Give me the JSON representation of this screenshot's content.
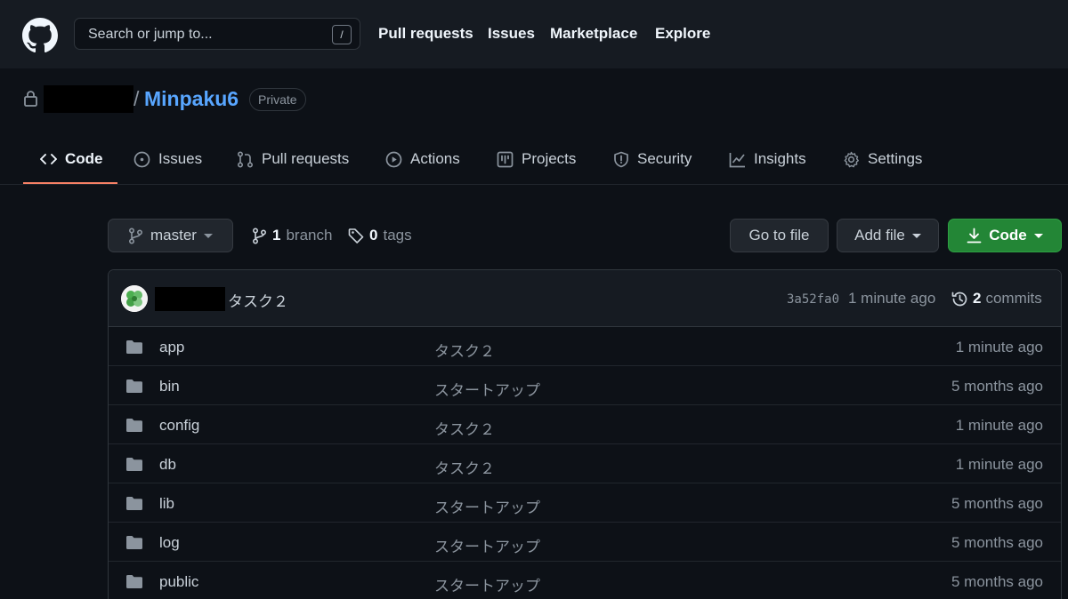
{
  "header": {
    "search_placeholder": "Search or jump to...",
    "search_shortcut": "/",
    "nav": [
      "Pull requests",
      "Issues",
      "Marketplace",
      "Explore"
    ]
  },
  "repo": {
    "separator": "/",
    "name": "Minpaku6",
    "visibility": "Private"
  },
  "tabs": [
    {
      "label": "Code",
      "icon": "code-icon",
      "active": true
    },
    {
      "label": "Issues",
      "icon": "issue-opened-icon"
    },
    {
      "label": "Pull requests",
      "icon": "git-pull-request-icon"
    },
    {
      "label": "Actions",
      "icon": "play-icon"
    },
    {
      "label": "Projects",
      "icon": "project-icon"
    },
    {
      "label": "Security",
      "icon": "shield-icon"
    },
    {
      "label": "Insights",
      "icon": "graph-icon"
    },
    {
      "label": "Settings",
      "icon": "gear-icon"
    }
  ],
  "branch_bar": {
    "branch": "master",
    "branch_count": "1",
    "branch_label": "branch",
    "tag_count": "0",
    "tag_label": "tags",
    "go_to_file": "Go to file",
    "add_file": "Add file",
    "code": "Code"
  },
  "latest_commit": {
    "message": "タスク２",
    "hash": "3a52fa0",
    "time": "1 minute ago",
    "commit_count": "2",
    "commit_label": "commits"
  },
  "files": [
    {
      "name": "app",
      "message": "タスク２",
      "time": "1 minute ago"
    },
    {
      "name": "bin",
      "message": "スタートアップ",
      "time": "5 months ago"
    },
    {
      "name": "config",
      "message": "タスク２",
      "time": "1 minute ago"
    },
    {
      "name": "db",
      "message": "タスク２",
      "time": "1 minute ago"
    },
    {
      "name": "lib",
      "message": "スタートアップ",
      "time": "5 months ago"
    },
    {
      "name": "log",
      "message": "スタートアップ",
      "time": "5 months ago"
    },
    {
      "name": "public",
      "message": "スタートアップ",
      "time": "5 months ago"
    }
  ],
  "colors": {
    "background": "#0d1117",
    "header": "#161b22",
    "link": "#58a6ff",
    "green_button": "#238636",
    "active_tab_underline": "#f78166"
  }
}
